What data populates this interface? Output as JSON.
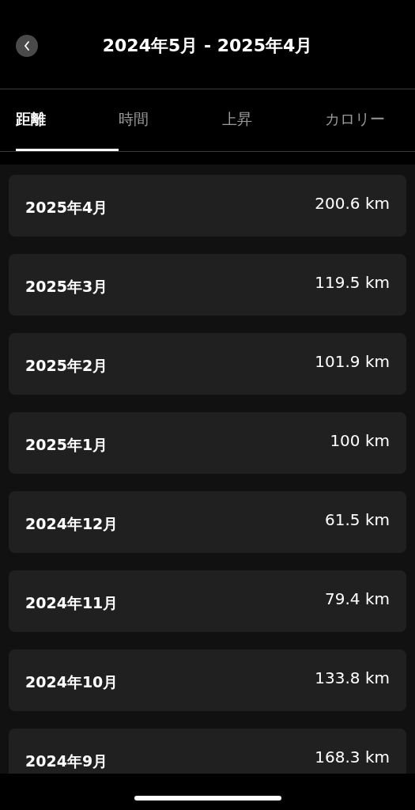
{
  "header": {
    "title": "2024年5月 - 2025年4月"
  },
  "tabs": [
    {
      "label": "距離",
      "selected": true
    },
    {
      "label": "時間",
      "selected": false
    },
    {
      "label": "上昇",
      "selected": false
    },
    {
      "label": "カロリー",
      "selected": false
    }
  ],
  "months": [
    {
      "month": "2025年4月",
      "distance": "200.6 km"
    },
    {
      "month": "2025年3月",
      "distance": "119.5 km"
    },
    {
      "month": "2025年2月",
      "distance": "101.9 km"
    },
    {
      "month": "2025年1月",
      "distance": "100 km"
    },
    {
      "month": "2024年12月",
      "distance": "61.5 km"
    },
    {
      "month": "2024年11月",
      "distance": "79.4 km"
    },
    {
      "month": "2024年10月",
      "distance": "133.8 km"
    },
    {
      "month": "2024年9月",
      "distance": "168.3 km"
    }
  ]
}
